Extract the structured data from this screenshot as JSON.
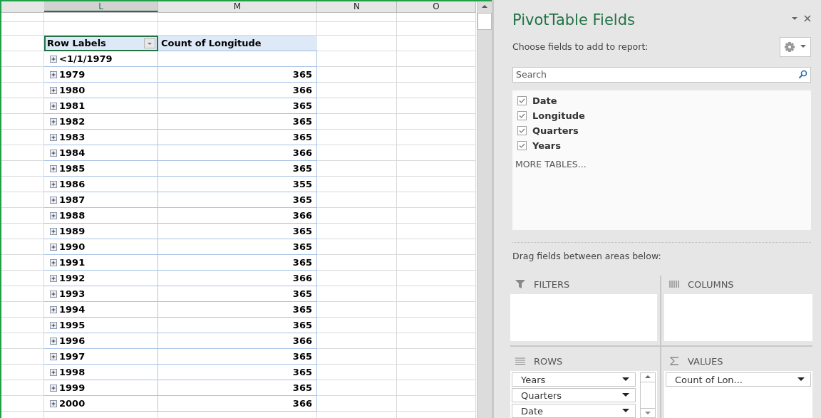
{
  "sheet": {
    "columns": [
      "L",
      "M",
      "N",
      "O"
    ],
    "pivot": {
      "row_header": "Row Labels",
      "value_header": "Count of Longitude",
      "rows": [
        {
          "label": "<1/1/1979",
          "count": ""
        },
        {
          "label": "1979",
          "count": "365"
        },
        {
          "label": "1980",
          "count": "366"
        },
        {
          "label": "1981",
          "count": "365"
        },
        {
          "label": "1982",
          "count": "365"
        },
        {
          "label": "1983",
          "count": "365"
        },
        {
          "label": "1984",
          "count": "366"
        },
        {
          "label": "1985",
          "count": "365"
        },
        {
          "label": "1986",
          "count": "355"
        },
        {
          "label": "1987",
          "count": "365"
        },
        {
          "label": "1988",
          "count": "366"
        },
        {
          "label": "1989",
          "count": "365"
        },
        {
          "label": "1990",
          "count": "365"
        },
        {
          "label": "1991",
          "count": "365"
        },
        {
          "label": "1992",
          "count": "366"
        },
        {
          "label": "1993",
          "count": "365"
        },
        {
          "label": "1994",
          "count": "365"
        },
        {
          "label": "1995",
          "count": "365"
        },
        {
          "label": "1996",
          "count": "366"
        },
        {
          "label": "1997",
          "count": "365"
        },
        {
          "label": "1998",
          "count": "365"
        },
        {
          "label": "1999",
          "count": "365"
        },
        {
          "label": "2000",
          "count": "366"
        }
      ]
    }
  },
  "panel": {
    "title": "PivotTable Fields",
    "choose_label": "Choose fields to add to report:",
    "search": {
      "placeholder": "Search"
    },
    "fields": [
      {
        "name": "Date",
        "checked": true
      },
      {
        "name": "Longitude",
        "checked": true
      },
      {
        "name": "Quarters",
        "checked": true
      },
      {
        "name": "Years",
        "checked": true
      }
    ],
    "more_tables": "MORE TABLES...",
    "drag_label": "Drag fields between areas below:",
    "areas": [
      {
        "kind": "filters",
        "label": "FILTERS"
      },
      {
        "kind": "columns",
        "label": "COLUMNS"
      },
      {
        "kind": "rows",
        "label": "ROWS",
        "items": [
          "Years",
          "Quarters",
          "Date"
        ]
      },
      {
        "kind": "values",
        "label": "VALUES",
        "items": [
          "Count of Lon..."
        ]
      }
    ]
  }
}
